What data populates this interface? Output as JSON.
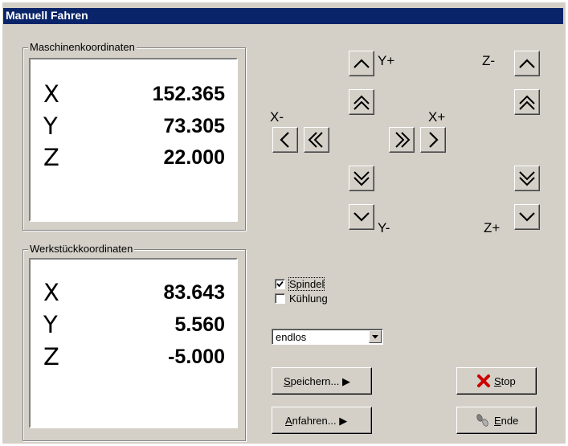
{
  "window": {
    "title": "Manuell Fahren"
  },
  "machine": {
    "label": "Maschinenkoordinaten",
    "rows": [
      {
        "axis": "X",
        "value": "152.365"
      },
      {
        "axis": "Y",
        "value": "73.305"
      },
      {
        "axis": "Z",
        "value": "22.000"
      }
    ]
  },
  "workpiece": {
    "label": "Werkstückkoordinaten",
    "rows": [
      {
        "axis": "X",
        "value": "83.643"
      },
      {
        "axis": "Y",
        "value": "5.560"
      },
      {
        "axis": "Z",
        "value": "-5.000"
      }
    ]
  },
  "jog": {
    "y_plus": "Y+",
    "y_minus": "Y-",
    "x_minus": "X-",
    "x_plus": "X+",
    "z_minus": "Z-",
    "z_plus": "Z+"
  },
  "options": {
    "spindle": {
      "label": "Spindel",
      "checked": true
    },
    "cooling": {
      "label": "Kühlung",
      "checked": false
    }
  },
  "mode": {
    "selected": "endlos"
  },
  "buttons": {
    "save": {
      "accel": "S",
      "rest": "peichern...",
      "arrow": "▶"
    },
    "approach": {
      "accel": "A",
      "rest": "nfahren...",
      "arrow": "▶"
    },
    "stop": {
      "accel": "S",
      "rest": "top"
    },
    "end": {
      "accel": "E",
      "rest": "nde"
    }
  },
  "colors": {
    "titlebar": "#0a246a",
    "face": "#d4d0c8",
    "stop_icon": "#cc0000"
  }
}
